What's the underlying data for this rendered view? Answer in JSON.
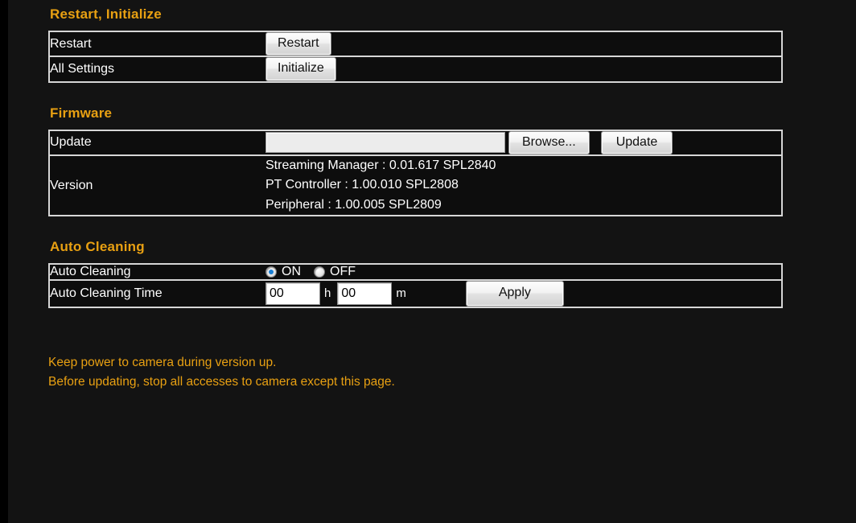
{
  "sections": [
    {
      "title": "Restart, Initialize",
      "rows": [
        {
          "label": "Restart",
          "button": "Restart"
        },
        {
          "label": "All Settings",
          "button": "Initialize"
        }
      ]
    },
    {
      "title": "Firmware",
      "update": {
        "label": "Update",
        "file_value": "",
        "file_placeholder": "",
        "browse_label": "Browse...",
        "update_label": "Update"
      },
      "version": {
        "label": "Version",
        "lines": [
          "Streaming Manager : 0.01.617 SPL2840",
          "PT Controller : 1.00.010 SPL2808",
          "Peripheral : 1.00.005 SPL2809"
        ]
      }
    },
    {
      "title": "Auto Cleaning",
      "toggle": {
        "label": "Auto Cleaning",
        "options": [
          {
            "label": "ON",
            "checked": true
          },
          {
            "label": "OFF",
            "checked": false
          }
        ]
      },
      "time": {
        "label": "Auto Cleaning Time",
        "hours_value": "00",
        "hours_unit": "h",
        "minutes_value": "00",
        "minutes_unit": "m",
        "apply_label": "Apply"
      }
    }
  ],
  "notice": {
    "line1": "Keep power to camera during version up.",
    "line2": "Before updating, stop all accesses to camera except this page."
  },
  "colors": {
    "accent": "#e8a012",
    "background": "#131313",
    "border": "#d6d6d6",
    "text": "#ffffff",
    "radio_dot": "#1a7fd4"
  }
}
